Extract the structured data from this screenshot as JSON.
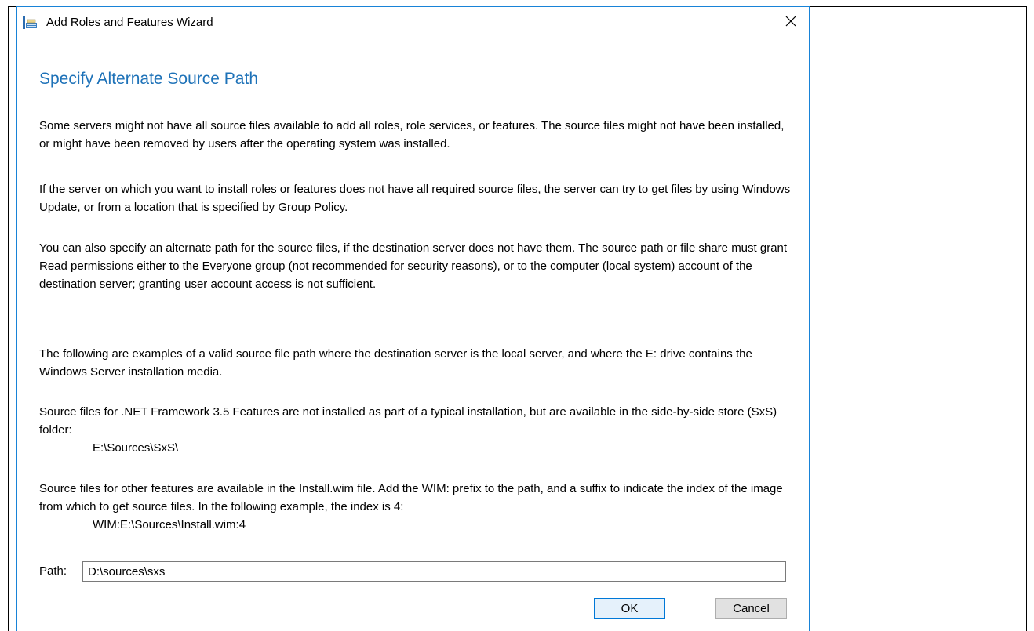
{
  "window": {
    "title": "Add Roles and Features Wizard",
    "icon": "server-manager-icon",
    "close_icon": "close-icon"
  },
  "main": {
    "heading": "Specify Alternate Source Path",
    "paragraphs": [
      "Some servers might not have all source files available to add all roles, role services, or features. The source files might not have been installed, or might have been removed by users after the operating system was installed.",
      "If the server on which you want to install roles or features does not have all required source files, the server can try to get files by using Windows Update, or from a location that is specified by Group Policy.",
      "You can also specify an alternate path for the source files, if the destination server does not have them. The source path or file share must grant Read permissions either to the Everyone group (not recommended for security reasons), or to the computer (local system) account of the destination server; granting user account access is not sufficient.",
      "The following are examples of a valid source file path where the destination server is the local server, and where the E: drive contains the Windows Server installation media.",
      "Source files for .NET Framework 3.5 Features are not installed as part of a typical installation, but are available in the side-by-side store (SxS) folder:",
      "Source files for other features are available in the Install.wim file. Add the WIM: prefix to the path, and a suffix to indicate the index of the image from which to get source files. In the following example, the index is 4:"
    ],
    "example_sxs": "E:\\Sources\\SxS\\",
    "example_wim": "WIM:E:\\Sources\\Install.wim:4"
  },
  "path": {
    "label": "Path:",
    "value": "D:\\sources\\sxs"
  },
  "buttons": {
    "ok": "OK",
    "cancel": "Cancel"
  },
  "colors": {
    "heading": "#1e72b8",
    "accent_border": "#0078d7"
  }
}
